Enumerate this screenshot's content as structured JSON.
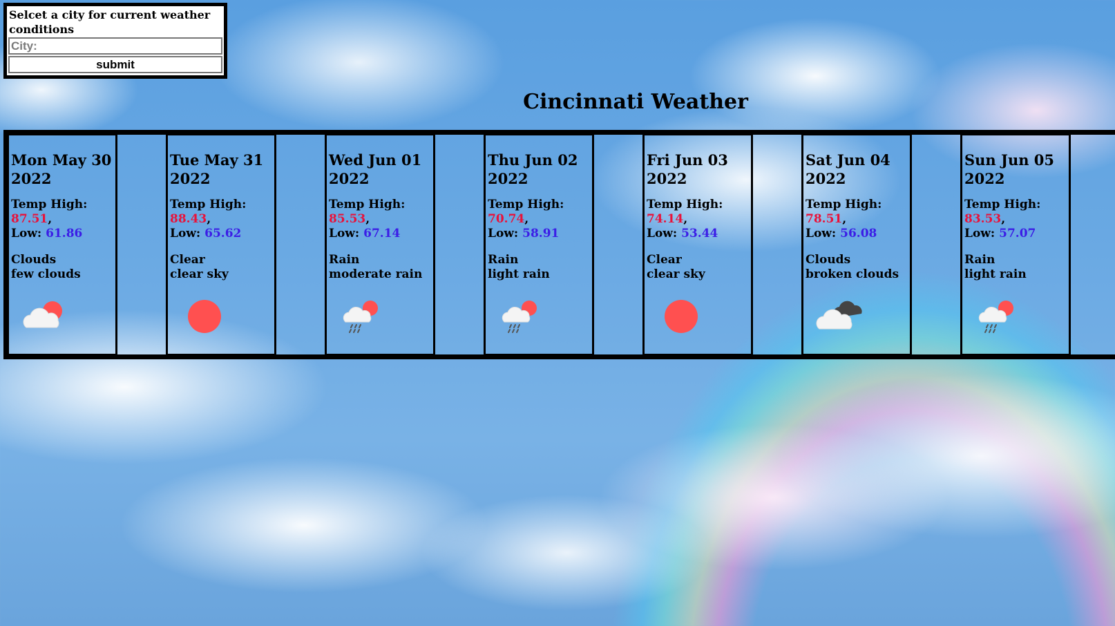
{
  "form": {
    "prompt": "Selcet a city for current weather conditions",
    "city_placeholder": "City:",
    "city_value": "",
    "submit_label": "submit"
  },
  "title": "Cincinnati Weather",
  "colors": {
    "high": "#e8123a",
    "low": "#3b1de6",
    "sun": "#ff5050"
  },
  "labels": {
    "high": "Temp High: ",
    "low": "Low: "
  },
  "days": [
    {
      "date": "Mon May 30",
      "year": "2022",
      "high": "87.51",
      "low": "61.86",
      "main": "Clouds",
      "desc": "few clouds",
      "icon": "few-clouds-icon"
    },
    {
      "date": "Tue May 31",
      "year": "2022",
      "high": "88.43",
      "low": "65.62",
      "main": "Clear",
      "desc": "clear sky",
      "icon": "clear-sky-icon"
    },
    {
      "date": "Wed Jun 01",
      "year": "2022",
      "high": "85.53",
      "low": "67.14",
      "main": "Rain",
      "desc": "moderate rain",
      "icon": "rain-icon"
    },
    {
      "date": "Thu Jun 02",
      "year": "2022",
      "high": "70.74",
      "low": "58.91",
      "main": "Rain",
      "desc": "light rain",
      "icon": "rain-icon"
    },
    {
      "date": "Fri Jun 03",
      "year": "2022",
      "high": "74.14",
      "low": "53.44",
      "main": "Clear",
      "desc": "clear sky",
      "icon": "clear-sky-icon"
    },
    {
      "date": "Sat Jun 04",
      "year": "2022",
      "high": "78.51",
      "low": "56.08",
      "main": "Clouds",
      "desc": "broken clouds",
      "icon": "broken-clouds-icon"
    },
    {
      "date": "Sun Jun 05",
      "year": "2022",
      "high": "83.53",
      "low": "57.07",
      "main": "Rain",
      "desc": "light rain",
      "icon": "rain-icon"
    }
  ]
}
